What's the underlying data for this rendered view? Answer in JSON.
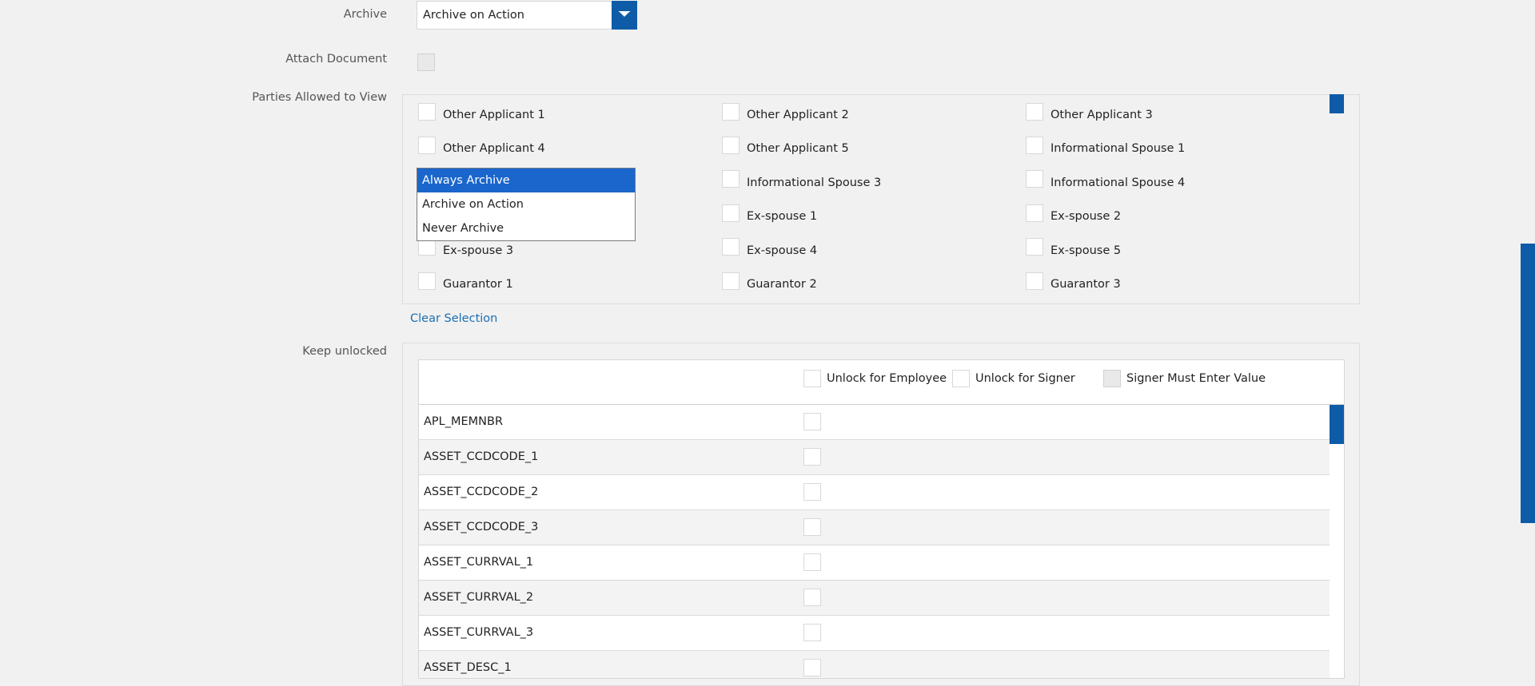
{
  "archive": {
    "label": "Archive",
    "selected": "Archive on Action",
    "options": [
      "Always Archive",
      "Archive on Action",
      "Never Archive"
    ]
  },
  "attach": {
    "label": "Attach Document"
  },
  "parties": {
    "label": "Parties Allowed to View",
    "col1": [
      "Other Applicant 1",
      "Other Applicant 4",
      "",
      "",
      "Ex-spouse 3",
      "Guarantor 1"
    ],
    "col2": [
      "Other Applicant 2",
      "Other Applicant 5",
      "Informational Spouse 3",
      "Ex-spouse 1",
      "Ex-spouse 4",
      "Guarantor 2"
    ],
    "col3": [
      "Other Applicant 3",
      "Informational Spouse 1",
      "Informational Spouse 4",
      "Ex-spouse 2",
      "Ex-spouse 5",
      "Guarantor 3"
    ],
    "clear_label": "Clear Selection"
  },
  "unlock": {
    "label": "Keep unlocked",
    "headers": [
      "Unlock for Employee",
      "Unlock for Signer",
      "Signer Must Enter Value"
    ],
    "rows": [
      "APL_MEMNBR",
      "ASSET_CCDCODE_1",
      "ASSET_CCDCODE_2",
      "ASSET_CCDCODE_3",
      "ASSET_CURRVAL_1",
      "ASSET_CURRVAL_2",
      "ASSET_CURRVAL_3",
      "ASSET_DESC_1"
    ]
  },
  "colors": {
    "accent": "#0e5ca8",
    "selected_option": "#1a66cc",
    "link": "#1a6fb3"
  }
}
